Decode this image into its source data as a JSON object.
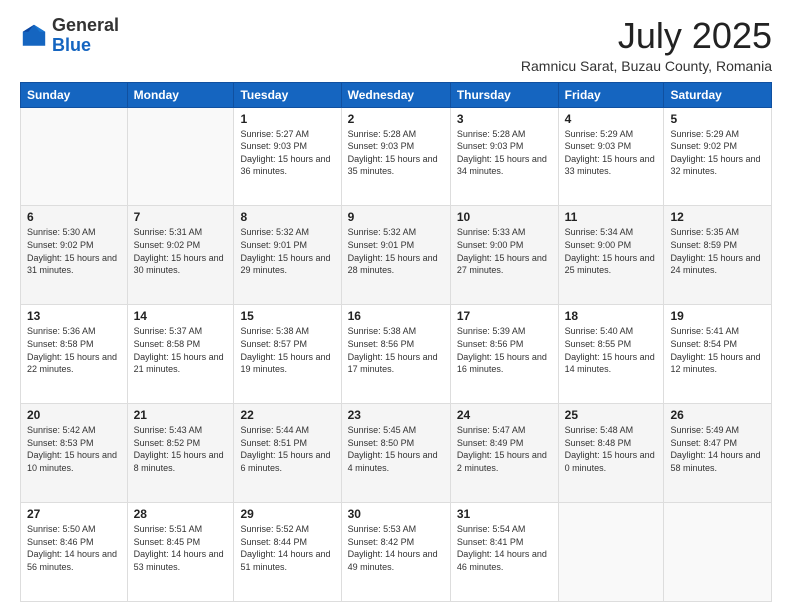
{
  "logo": {
    "general": "General",
    "blue": "Blue"
  },
  "header": {
    "month": "July 2025",
    "location": "Ramnicu Sarat, Buzau County, Romania"
  },
  "days_of_week": [
    "Sunday",
    "Monday",
    "Tuesday",
    "Wednesday",
    "Thursday",
    "Friday",
    "Saturday"
  ],
  "weeks": [
    [
      {
        "day": "",
        "detail": ""
      },
      {
        "day": "",
        "detail": ""
      },
      {
        "day": "1",
        "detail": "Sunrise: 5:27 AM\nSunset: 9:03 PM\nDaylight: 15 hours and 36 minutes."
      },
      {
        "day": "2",
        "detail": "Sunrise: 5:28 AM\nSunset: 9:03 PM\nDaylight: 15 hours and 35 minutes."
      },
      {
        "day": "3",
        "detail": "Sunrise: 5:28 AM\nSunset: 9:03 PM\nDaylight: 15 hours and 34 minutes."
      },
      {
        "day": "4",
        "detail": "Sunrise: 5:29 AM\nSunset: 9:03 PM\nDaylight: 15 hours and 33 minutes."
      },
      {
        "day": "5",
        "detail": "Sunrise: 5:29 AM\nSunset: 9:02 PM\nDaylight: 15 hours and 32 minutes."
      }
    ],
    [
      {
        "day": "6",
        "detail": "Sunrise: 5:30 AM\nSunset: 9:02 PM\nDaylight: 15 hours and 31 minutes."
      },
      {
        "day": "7",
        "detail": "Sunrise: 5:31 AM\nSunset: 9:02 PM\nDaylight: 15 hours and 30 minutes."
      },
      {
        "day": "8",
        "detail": "Sunrise: 5:32 AM\nSunset: 9:01 PM\nDaylight: 15 hours and 29 minutes."
      },
      {
        "day": "9",
        "detail": "Sunrise: 5:32 AM\nSunset: 9:01 PM\nDaylight: 15 hours and 28 minutes."
      },
      {
        "day": "10",
        "detail": "Sunrise: 5:33 AM\nSunset: 9:00 PM\nDaylight: 15 hours and 27 minutes."
      },
      {
        "day": "11",
        "detail": "Sunrise: 5:34 AM\nSunset: 9:00 PM\nDaylight: 15 hours and 25 minutes."
      },
      {
        "day": "12",
        "detail": "Sunrise: 5:35 AM\nSunset: 8:59 PM\nDaylight: 15 hours and 24 minutes."
      }
    ],
    [
      {
        "day": "13",
        "detail": "Sunrise: 5:36 AM\nSunset: 8:58 PM\nDaylight: 15 hours and 22 minutes."
      },
      {
        "day": "14",
        "detail": "Sunrise: 5:37 AM\nSunset: 8:58 PM\nDaylight: 15 hours and 21 minutes."
      },
      {
        "day": "15",
        "detail": "Sunrise: 5:38 AM\nSunset: 8:57 PM\nDaylight: 15 hours and 19 minutes."
      },
      {
        "day": "16",
        "detail": "Sunrise: 5:38 AM\nSunset: 8:56 PM\nDaylight: 15 hours and 17 minutes."
      },
      {
        "day": "17",
        "detail": "Sunrise: 5:39 AM\nSunset: 8:56 PM\nDaylight: 15 hours and 16 minutes."
      },
      {
        "day": "18",
        "detail": "Sunrise: 5:40 AM\nSunset: 8:55 PM\nDaylight: 15 hours and 14 minutes."
      },
      {
        "day": "19",
        "detail": "Sunrise: 5:41 AM\nSunset: 8:54 PM\nDaylight: 15 hours and 12 minutes."
      }
    ],
    [
      {
        "day": "20",
        "detail": "Sunrise: 5:42 AM\nSunset: 8:53 PM\nDaylight: 15 hours and 10 minutes."
      },
      {
        "day": "21",
        "detail": "Sunrise: 5:43 AM\nSunset: 8:52 PM\nDaylight: 15 hours and 8 minutes."
      },
      {
        "day": "22",
        "detail": "Sunrise: 5:44 AM\nSunset: 8:51 PM\nDaylight: 15 hours and 6 minutes."
      },
      {
        "day": "23",
        "detail": "Sunrise: 5:45 AM\nSunset: 8:50 PM\nDaylight: 15 hours and 4 minutes."
      },
      {
        "day": "24",
        "detail": "Sunrise: 5:47 AM\nSunset: 8:49 PM\nDaylight: 15 hours and 2 minutes."
      },
      {
        "day": "25",
        "detail": "Sunrise: 5:48 AM\nSunset: 8:48 PM\nDaylight: 15 hours and 0 minutes."
      },
      {
        "day": "26",
        "detail": "Sunrise: 5:49 AM\nSunset: 8:47 PM\nDaylight: 14 hours and 58 minutes."
      }
    ],
    [
      {
        "day": "27",
        "detail": "Sunrise: 5:50 AM\nSunset: 8:46 PM\nDaylight: 14 hours and 56 minutes."
      },
      {
        "day": "28",
        "detail": "Sunrise: 5:51 AM\nSunset: 8:45 PM\nDaylight: 14 hours and 53 minutes."
      },
      {
        "day": "29",
        "detail": "Sunrise: 5:52 AM\nSunset: 8:44 PM\nDaylight: 14 hours and 51 minutes."
      },
      {
        "day": "30",
        "detail": "Sunrise: 5:53 AM\nSunset: 8:42 PM\nDaylight: 14 hours and 49 minutes."
      },
      {
        "day": "31",
        "detail": "Sunrise: 5:54 AM\nSunset: 8:41 PM\nDaylight: 14 hours and 46 minutes."
      },
      {
        "day": "",
        "detail": ""
      },
      {
        "day": "",
        "detail": ""
      }
    ]
  ]
}
